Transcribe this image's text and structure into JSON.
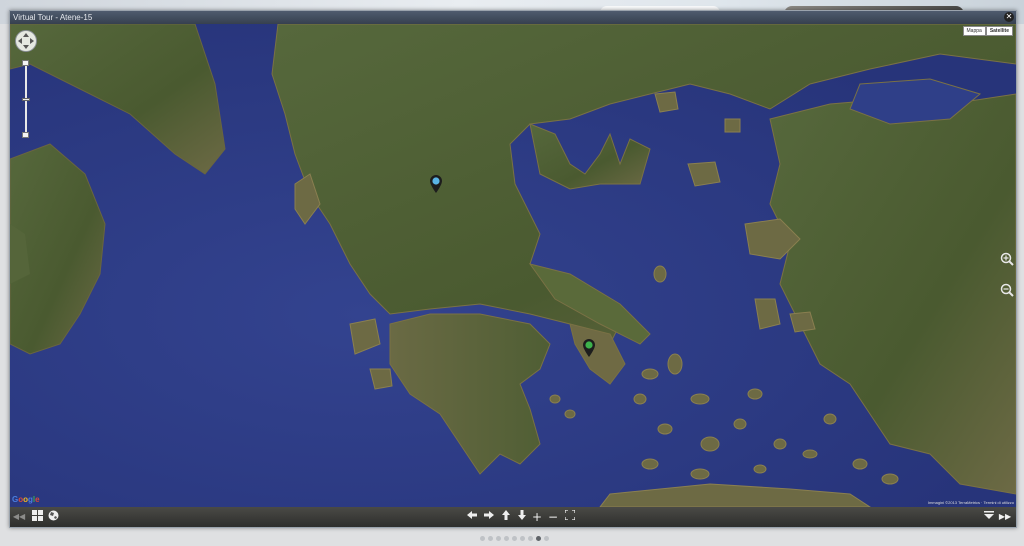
{
  "window": {
    "title": "Virtual Tour - Atene-15",
    "close_label": "✕"
  },
  "map": {
    "map_types": [
      "Mappa",
      "Satellite"
    ],
    "active_map_type": "Satellite",
    "logo": "Google",
    "copyright": "Immagini ©2013 TerraMetrics · Termini di utilizzo",
    "markers": [
      {
        "name": "marker-north",
        "color": "#5ab4e6"
      },
      {
        "name": "marker-athens",
        "color": "#3db24b"
      }
    ],
    "zoom_in_label": "+",
    "zoom_out_label": "−"
  },
  "toolbar": {
    "prev_label": "◀◀",
    "plus_label": "+",
    "minus_label": "−",
    "next_label": "▶▶"
  },
  "pager": {
    "count": 9,
    "active_index": 7
  },
  "colors": {
    "sea": "#2f3f88",
    "land": "#4c5a34",
    "toolbar": "#3a3a37"
  }
}
